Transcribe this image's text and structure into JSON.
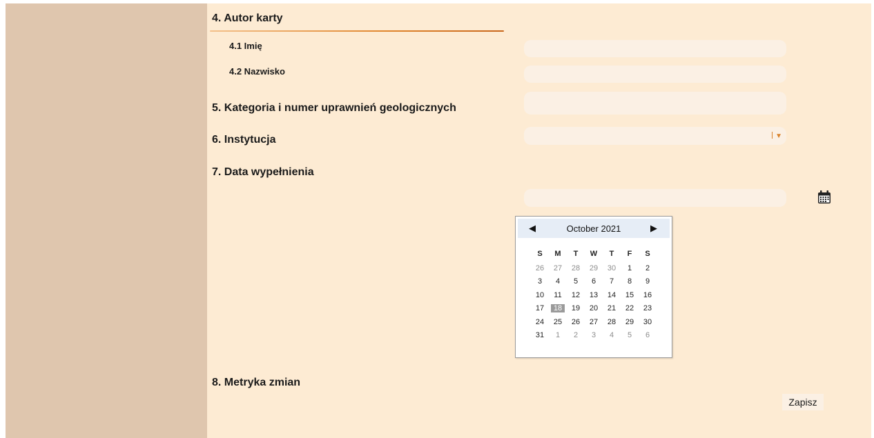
{
  "sections": {
    "author": {
      "title": "4. Autor karty",
      "first_name_label": "4.1 Imię",
      "first_name_value": "",
      "last_name_label": "4.2 Nazwisko",
      "last_name_value": ""
    },
    "category": {
      "title": "5. Kategoria i numer uprawnień geologicznych",
      "value": ""
    },
    "institution": {
      "title": "6. Instytucja",
      "value": ""
    },
    "date": {
      "title": "7. Data wypełnienia",
      "value": ""
    },
    "changes": {
      "title": "8. Metryka zmian"
    }
  },
  "calendar": {
    "month_label": "October 2021",
    "prev_icon": "triangle-left-icon",
    "next_icon": "triangle-right-icon",
    "weekdays": [
      "S",
      "M",
      "T",
      "W",
      "T",
      "F",
      "S"
    ],
    "weeks": [
      [
        "26",
        "27",
        "28",
        "29",
        "30",
        "1",
        "2"
      ],
      [
        "3",
        "4",
        "5",
        "6",
        "7",
        "8",
        "9"
      ],
      [
        "10",
        "11",
        "12",
        "13",
        "14",
        "15",
        "16"
      ],
      [
        "17",
        "18",
        "19",
        "20",
        "21",
        "22",
        "23"
      ],
      [
        "24",
        "25",
        "26",
        "27",
        "28",
        "29",
        "30"
      ],
      [
        "31",
        "1",
        "2",
        "3",
        "4",
        "5",
        "6"
      ]
    ],
    "selected_day": "18"
  },
  "actions": {
    "save_label": "Zapisz"
  },
  "colors": {
    "page_bg": "#fdebd3",
    "sidebar_bg": "#dfc6ae",
    "field_bg": "#fbf0e4",
    "accent": "#e0852c",
    "selected_day_bg": "#9a9a9a"
  }
}
